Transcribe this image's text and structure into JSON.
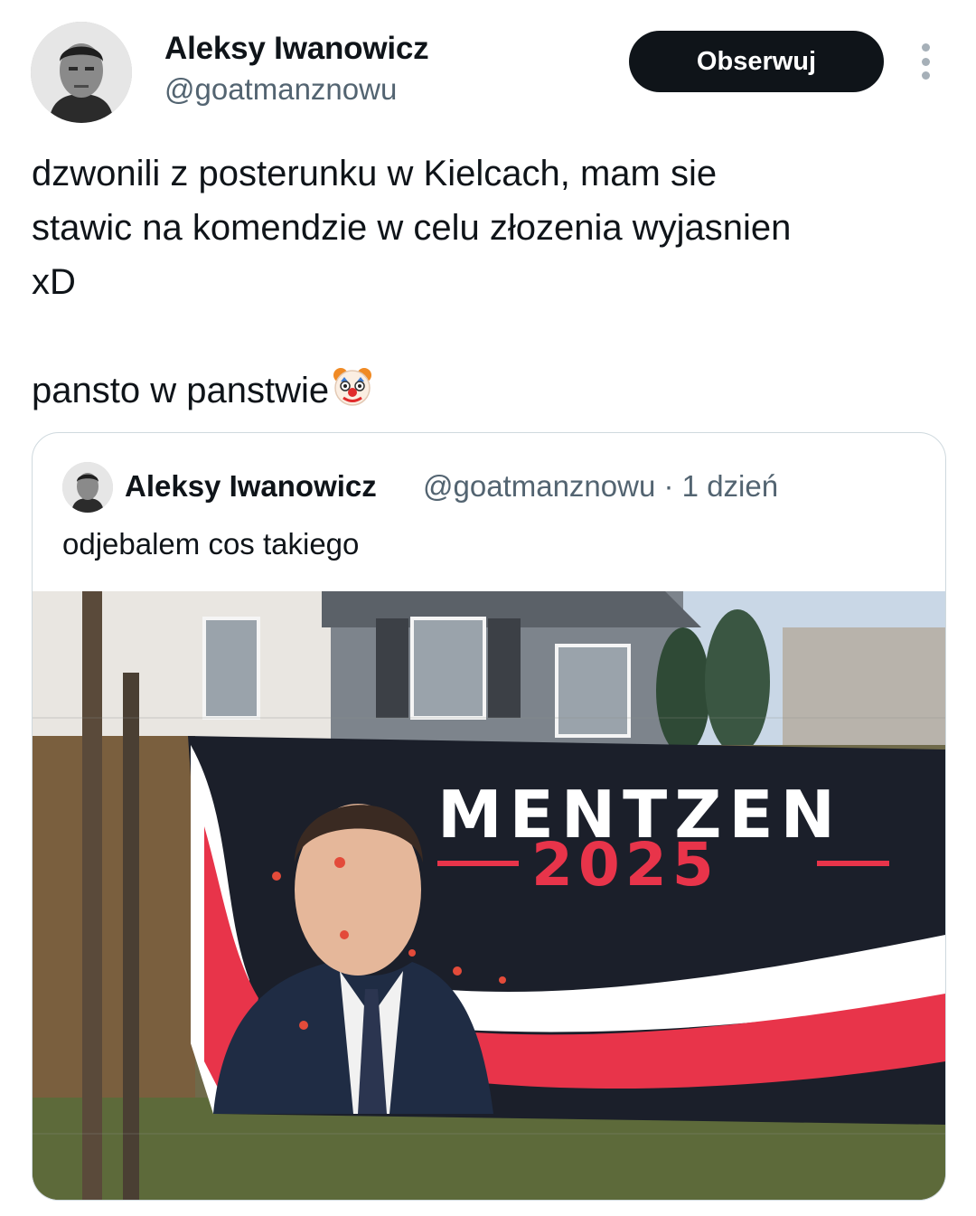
{
  "author": {
    "name": "Aleksy Iwanowicz",
    "handle": "@goatmanznowu",
    "avatar_icon": "profile-photo-icon"
  },
  "actions": {
    "follow_label": "Obserwuj",
    "more_icon": "more-vertical-icon"
  },
  "tweet": {
    "line1": "dzwonili z posterunku w Kielcach, mam sie",
    "line2": "stawic na komendzie w celu złozenia wyjasnien",
    "line3": "xD",
    "line4": "pansto w panstwie",
    "emoji": "clown-face-icon"
  },
  "quote": {
    "name": "Aleksy Iwanowicz",
    "handle": "@goatmanznowu",
    "separator": "·",
    "time": "1 dzień",
    "text": "odjebalem cos takiego",
    "image": {
      "banner_title": "MENTZEN",
      "banner_year": "2025",
      "colors": {
        "banner_bg": "#1b1f2a",
        "red": "#e8344a",
        "white": "#ffffff"
      }
    }
  },
  "colors": {
    "text": "#0f1419",
    "muted": "#536471",
    "border": "#cfd9de",
    "button": "#0f1419"
  }
}
